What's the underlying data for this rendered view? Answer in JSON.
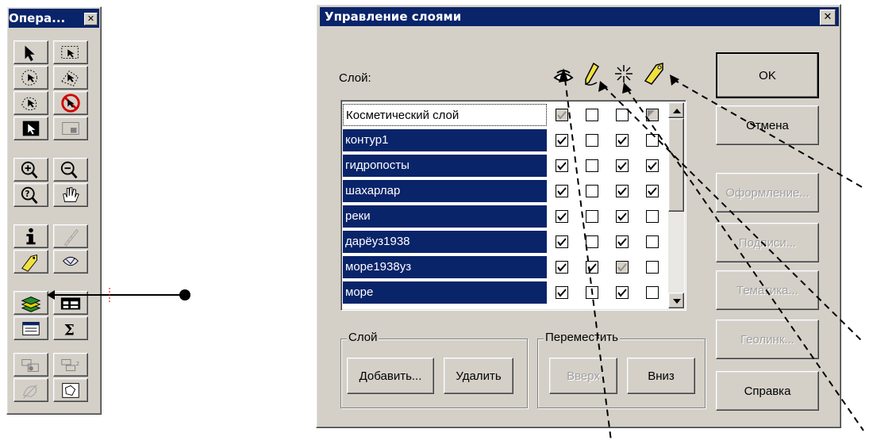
{
  "toolbox": {
    "title": "Опера...",
    "close_glyph": "✕",
    "buttons": [
      {
        "name": "select-arrow"
      },
      {
        "name": "marquee-select"
      },
      {
        "name": "radius-select"
      },
      {
        "name": "polygon-select"
      },
      {
        "name": "boundary-select"
      },
      {
        "name": "invert-select"
      },
      {
        "name": "graph-select"
      },
      {
        "name": "label-select"
      },
      {
        "name": "zoom-in"
      },
      {
        "name": "zoom-out"
      },
      {
        "name": "change-view"
      },
      {
        "name": "pan-hand"
      },
      {
        "name": "info"
      },
      {
        "name": "ruler"
      },
      {
        "name": "label-tool"
      },
      {
        "name": "drag-map"
      },
      {
        "name": "layer-control"
      },
      {
        "name": "legend"
      },
      {
        "name": "statistics-window"
      },
      {
        "name": "sigma-calc"
      },
      {
        "name": "clip-region"
      },
      {
        "name": "hotlink"
      },
      {
        "name": "set-clip"
      },
      {
        "name": "reshape"
      }
    ]
  },
  "dialog": {
    "title": "Управление слоями",
    "close_glyph": "✕",
    "layer_label": "Слой:",
    "column_icons": [
      "eye-icon",
      "pencil-icon",
      "selectable-icon",
      "label-tag-icon"
    ],
    "layers": [
      {
        "name": "Косметический слой",
        "selected": false,
        "checks": [
          "grey-check",
          "off",
          "off",
          "grey-corner"
        ]
      },
      {
        "name": "контур1",
        "selected": true,
        "checks": [
          "on",
          "off",
          "on",
          "off"
        ]
      },
      {
        "name": "гидропосты",
        "selected": true,
        "checks": [
          "on",
          "off",
          "on",
          "on"
        ]
      },
      {
        "name": "шахарлар",
        "selected": true,
        "checks": [
          "on",
          "off",
          "on",
          "on"
        ]
      },
      {
        "name": "реки",
        "selected": true,
        "checks": [
          "on",
          "off",
          "on",
          "off"
        ]
      },
      {
        "name": "дарёуз1938",
        "selected": true,
        "checks": [
          "on",
          "off",
          "on",
          "off"
        ]
      },
      {
        "name": "море1938уз",
        "selected": true,
        "checks": [
          "on",
          "on",
          "grey-check",
          "off"
        ]
      },
      {
        "name": "море",
        "selected": true,
        "checks": [
          "on",
          "off",
          "on",
          "off"
        ]
      }
    ],
    "buttons": {
      "ok": "OK",
      "cancel": "Отмена",
      "display": "Оформление...",
      "labels": "Подписи...",
      "thematic": "Тематика...",
      "geolink": "Геолинк...",
      "help": "Справка"
    },
    "layer_group": {
      "title": "Слой",
      "add": "Добавить...",
      "remove": "Удалить"
    },
    "move_group": {
      "title": "Переместить",
      "up": "Вверх",
      "down": "Вниз"
    }
  },
  "colors": {
    "selection": "#0a246a",
    "face": "#d4d0c8"
  }
}
